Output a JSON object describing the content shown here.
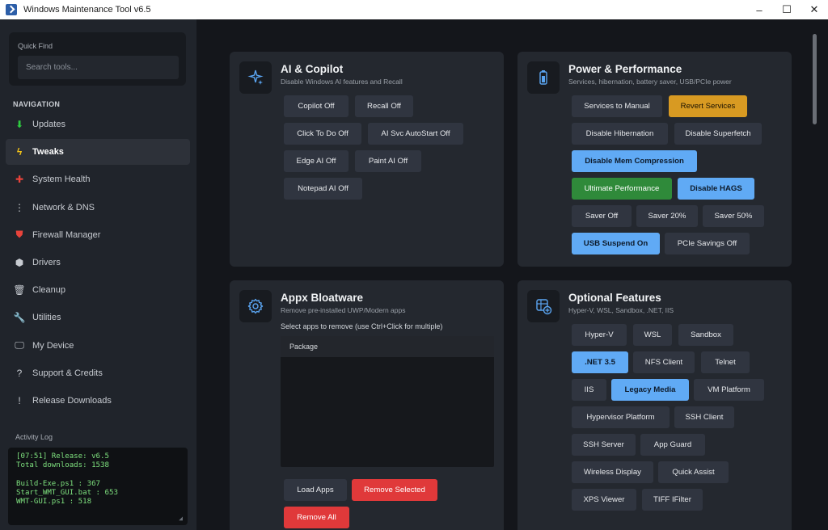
{
  "window": {
    "title": "Windows Maintenance Tool v6.5",
    "minimize": "–",
    "maximize": "☐",
    "close": "✕"
  },
  "sidebar": {
    "quick_find": {
      "label": "Quick Find",
      "placeholder": "Search tools..."
    },
    "nav_heading": "NAVIGATION",
    "items": [
      {
        "label": "Updates",
        "icon": "download-icon",
        "glyph": "⬇",
        "color": "#2ecc40"
      },
      {
        "label": "Tweaks",
        "icon": "lightning-icon",
        "glyph": "ϟ",
        "color": "#f5c518"
      },
      {
        "label": "System Health",
        "icon": "health-cross-icon",
        "glyph": "✚",
        "color": "#e8433b"
      },
      {
        "label": "Network & DNS",
        "icon": "network-icon",
        "glyph": "⋮",
        "color": "#c7cbd1"
      },
      {
        "label": "Firewall Manager",
        "icon": "shield-icon",
        "glyph": "⛊",
        "color": "#e8433b"
      },
      {
        "label": "Drivers",
        "icon": "drivers-icon",
        "glyph": "⬢",
        "color": "#c7cbd1"
      },
      {
        "label": "Cleanup",
        "icon": "trash-icon",
        "glyph": "🗑",
        "color": "#c7cbd1"
      },
      {
        "label": "Utilities",
        "icon": "wrench-icon",
        "glyph": "🔧",
        "color": "#c7cbd1"
      },
      {
        "label": "My Device",
        "icon": "monitor-icon",
        "glyph": "🖵",
        "color": "#c7cbd1"
      },
      {
        "label": "Support & Credits",
        "icon": "question-icon",
        "glyph": "?",
        "color": "#c7cbd1"
      },
      {
        "label": "Release Downloads",
        "icon": "info-icon",
        "glyph": "!",
        "color": "#c7cbd1"
      }
    ],
    "active_item": "Tweaks",
    "activity_label": "Activity Log",
    "log": "[07:51] Release: v6.5\nTotal downloads: 1538\n\nBuild-Exe.ps1 : 367\nStart_WMT_GUI.bat : 653\nWMT-GUI.ps1 : 518"
  },
  "cards": {
    "ai": {
      "title": "AI & Copilot",
      "subtitle": "Disable Windows AI features and Recall",
      "icon": "sparkle-icon",
      "buttons": [
        "Copilot Off",
        "Recall Off",
        "Click To Do Off",
        "AI Svc AutoStart Off",
        "Edge AI Off",
        "Paint AI Off",
        "Notepad AI Off"
      ]
    },
    "power": {
      "title": "Power & Performance",
      "subtitle": "Services, hibernation, battery saver, USB/PCIe power",
      "icon": "battery-icon",
      "buttons": [
        "Services to Manual",
        "Revert Services",
        "Disable Hibernation",
        "Disable Superfetch",
        "Disable Mem Compression",
        "Ultimate Performance",
        "Disable HAGS",
        "Saver Off",
        "Saver 20%",
        "Saver 50%",
        "USB Suspend On",
        "PCIe Savings Off"
      ]
    },
    "appx": {
      "title": "Appx Bloatware",
      "subtitle": "Remove pre-installed UWP/Modern apps",
      "icon": "gear-icon",
      "select_text": "Select apps to remove (use Ctrl+Click for multiple)",
      "column": "Package",
      "buttons": [
        "Load Apps",
        "Remove Selected",
        "Remove All"
      ]
    },
    "optional": {
      "title": "Optional Features",
      "subtitle": "Hyper-V, WSL, Sandbox, .NET, IIS",
      "icon": "add-feature-icon",
      "buttons": [
        "Hyper-V",
        "WSL",
        "Sandbox",
        ".NET 3.5",
        "NFS Client",
        "Telnet",
        "IIS",
        "Legacy Media",
        "VM Platform",
        "Hypervisor Platform",
        "SSH Client",
        "SSH Server",
        "App Guard",
        "Wireless Display",
        "Quick Assist",
        "XPS Viewer",
        "TIFF IFilter"
      ]
    }
  },
  "colors": {
    "blue": "#60aaf5",
    "green": "#2f8a3a",
    "amber": "#d89a22",
    "red": "#e0393a"
  }
}
